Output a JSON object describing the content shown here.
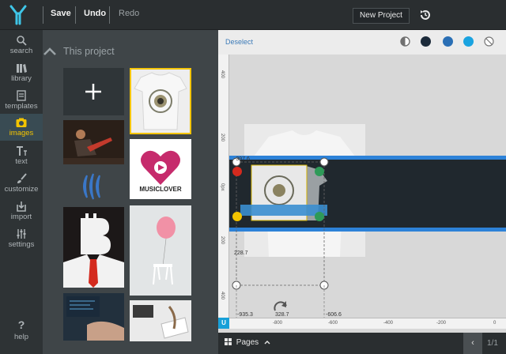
{
  "toolbar": {
    "save": "Save",
    "undo": "Undo",
    "redo": "Redo",
    "new_project": "New Project"
  },
  "nav": {
    "items": [
      {
        "label": "search",
        "icon": "search-icon"
      },
      {
        "label": "library",
        "icon": "library-icon"
      },
      {
        "label": "templates",
        "icon": "templates-icon"
      },
      {
        "label": "images",
        "icon": "camera-icon",
        "active": true
      },
      {
        "label": "text",
        "icon": "text-icon"
      },
      {
        "label": "customize",
        "icon": "brush-icon"
      },
      {
        "label": "import",
        "icon": "import-icon"
      },
      {
        "label": "settings",
        "icon": "sliders-icon"
      },
      {
        "label": "help",
        "icon": "help-icon"
      }
    ]
  },
  "panel": {
    "heading": "This project",
    "music_lover_text": "MUSICLOVER"
  },
  "workspace": {
    "deselect": "Deselect",
    "colors": [
      "#707070",
      "#1c2b3a",
      "#2a6fb5",
      "#1aa3e0",
      "#ffffff"
    ],
    "ruler_left_labels": [
      "400",
      "200",
      "0px",
      "200",
      "400"
    ],
    "ruler_bottom_labels": [
      "-800",
      "-600",
      "-400",
      "-200",
      "0"
    ],
    "handle_labels": {
      "top_left": "-397.6",
      "bottom_left": "228.7",
      "bottom_left_x": "-935.3",
      "bottom_mid_x": "328.7",
      "bottom_right_x": "-606.6"
    },
    "u_badge": "U",
    "pages": "Pages",
    "pager": "1/1"
  }
}
